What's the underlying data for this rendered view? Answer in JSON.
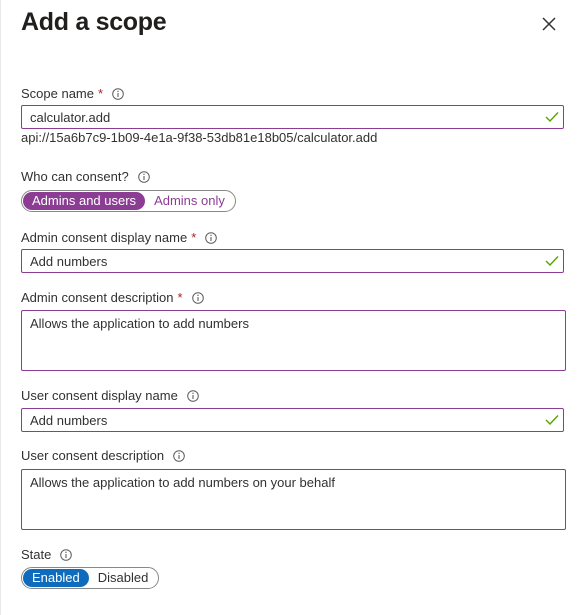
{
  "panel": {
    "title": "Add a scope",
    "close_icon": "close-icon"
  },
  "fields": {
    "scope_name": {
      "label": "Scope name",
      "required_mark": "*",
      "value": "calculator.add",
      "uri": "api://15a6b7c9-1b09-4e1a-9f38-53db81e18b05/calculator.add"
    },
    "who_can_consent": {
      "label": "Who can consent?",
      "options": [
        "Admins and users",
        "Admins only"
      ],
      "selected": "Admins and users"
    },
    "admin_display_name": {
      "label": "Admin consent display name",
      "required_mark": "*",
      "value": "Add numbers"
    },
    "admin_description": {
      "label": "Admin consent description",
      "required_mark": "*",
      "value": "Allows the application to add numbers"
    },
    "user_display_name": {
      "label": "User consent display name",
      "value": "Add numbers"
    },
    "user_description": {
      "label": "User consent description",
      "value": "Allows the application to add numbers on your behalf"
    },
    "state": {
      "label": "State",
      "options": [
        "Enabled",
        "Disabled"
      ],
      "selected": "Enabled"
    }
  },
  "colors": {
    "accent_purple": "#8a3d93",
    "accent_blue": "#0f6cbd",
    "valid_green": "#57a300",
    "required_red": "#a4262c"
  }
}
